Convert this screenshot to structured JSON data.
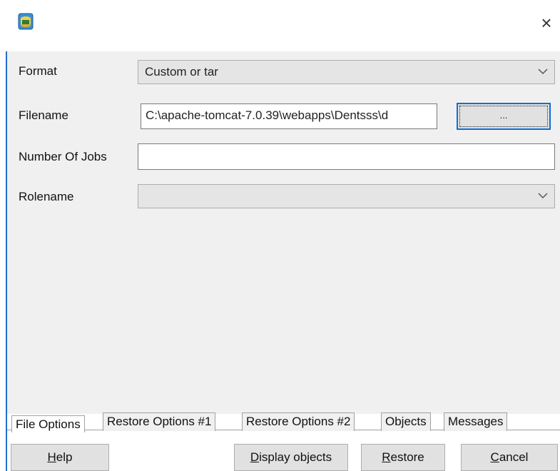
{
  "dialog": {
    "close_label": "×"
  },
  "form": {
    "format": {
      "label": "Format",
      "value": "Custom or tar"
    },
    "filename": {
      "label": "Filename",
      "value": "C:\\apache-tomcat-7.0.39\\webapps\\Dentsss\\d",
      "browse_label": "..."
    },
    "jobs": {
      "label": "Number Of Jobs",
      "value": ""
    },
    "rolename": {
      "label": "Rolename",
      "value": ""
    }
  },
  "tabs": [
    {
      "label": "File Options",
      "active": true
    },
    {
      "label": "Restore Options #1"
    },
    {
      "label": "Restore Options #2"
    },
    {
      "label": "Objects"
    },
    {
      "label": "Messages"
    }
  ],
  "buttons": {
    "help": {
      "first": "H",
      "rest": "elp"
    },
    "display": {
      "first": "D",
      "rest": "isplay objects"
    },
    "restore": {
      "first": "R",
      "rest": "estore"
    },
    "cancel": {
      "first": "C",
      "rest": "ancel"
    }
  },
  "colors": {
    "accent": "#0c6fd6",
    "panel": "#f0f0f0",
    "combo": "#e5e5e5"
  }
}
